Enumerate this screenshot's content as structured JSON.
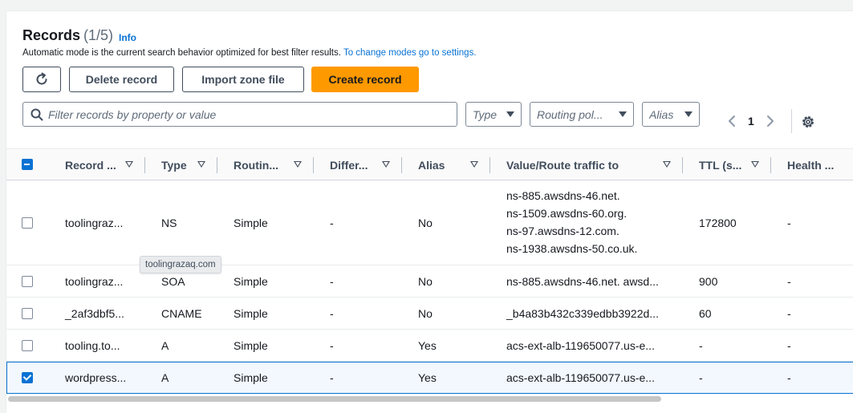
{
  "header": {
    "title": "Records",
    "count": "(1/5)",
    "info_label": "Info",
    "description": "Automatic mode is the current search behavior optimized for best filter results.",
    "description_link": "To change modes go to settings."
  },
  "toolbar": {
    "refresh_icon": "refresh-icon",
    "delete_label": "Delete record",
    "import_label": "Import zone file",
    "create_label": "Create record"
  },
  "filters": {
    "search_placeholder": "Filter records by property or value",
    "type_placeholder": "Type",
    "routing_placeholder": "Routing pol...",
    "alias_placeholder": "Alias"
  },
  "pagination": {
    "current_page": "1"
  },
  "table": {
    "columns": [
      "Record ...",
      "Type",
      "Routin...",
      "Differ...",
      "Alias",
      "Value/Route traffic to",
      "TTL (s...",
      "Health ..."
    ],
    "rows": [
      {
        "name": "toolingraz...",
        "type": "NS",
        "routing": "Simple",
        "differ": "-",
        "alias": "No",
        "value": [
          "ns-885.awsdns-46.net.",
          "ns-1509.awsdns-60.org.",
          "ns-97.awsdns-12.com.",
          "ns-1938.awsdns-50.co.uk."
        ],
        "ttl": "172800",
        "health": "-",
        "checked": false
      },
      {
        "name": "toolingraz...",
        "type": "SOA",
        "routing": "Simple",
        "differ": "-",
        "alias": "No",
        "value": [
          "ns-885.awsdns-46.net. awsd..."
        ],
        "ttl": "900",
        "health": "-",
        "checked": false
      },
      {
        "name": "_2af3dbf5...",
        "type": "CNAME",
        "routing": "Simple",
        "differ": "-",
        "alias": "No",
        "value": [
          "_b4a83b432c339edbb3922d..."
        ],
        "ttl": "60",
        "health": "-",
        "checked": false
      },
      {
        "name": "tooling.to...",
        "type": "A",
        "routing": "Simple",
        "differ": "-",
        "alias": "Yes",
        "value": [
          "acs-ext-alb-119650077.us-e..."
        ],
        "ttl": "-",
        "health": "-",
        "checked": false
      },
      {
        "name": "wordpress...",
        "type": "A",
        "routing": "Simple",
        "differ": "-",
        "alias": "Yes",
        "value": [
          "acs-ext-alb-119650077.us-e..."
        ],
        "ttl": "-",
        "health": "-",
        "checked": true
      }
    ]
  },
  "tooltip": {
    "text": "toolingrazaq.com"
  },
  "colors": {
    "accent": "#ff9900",
    "link": "#0972d3",
    "selected_row": "#f2f8fd"
  }
}
